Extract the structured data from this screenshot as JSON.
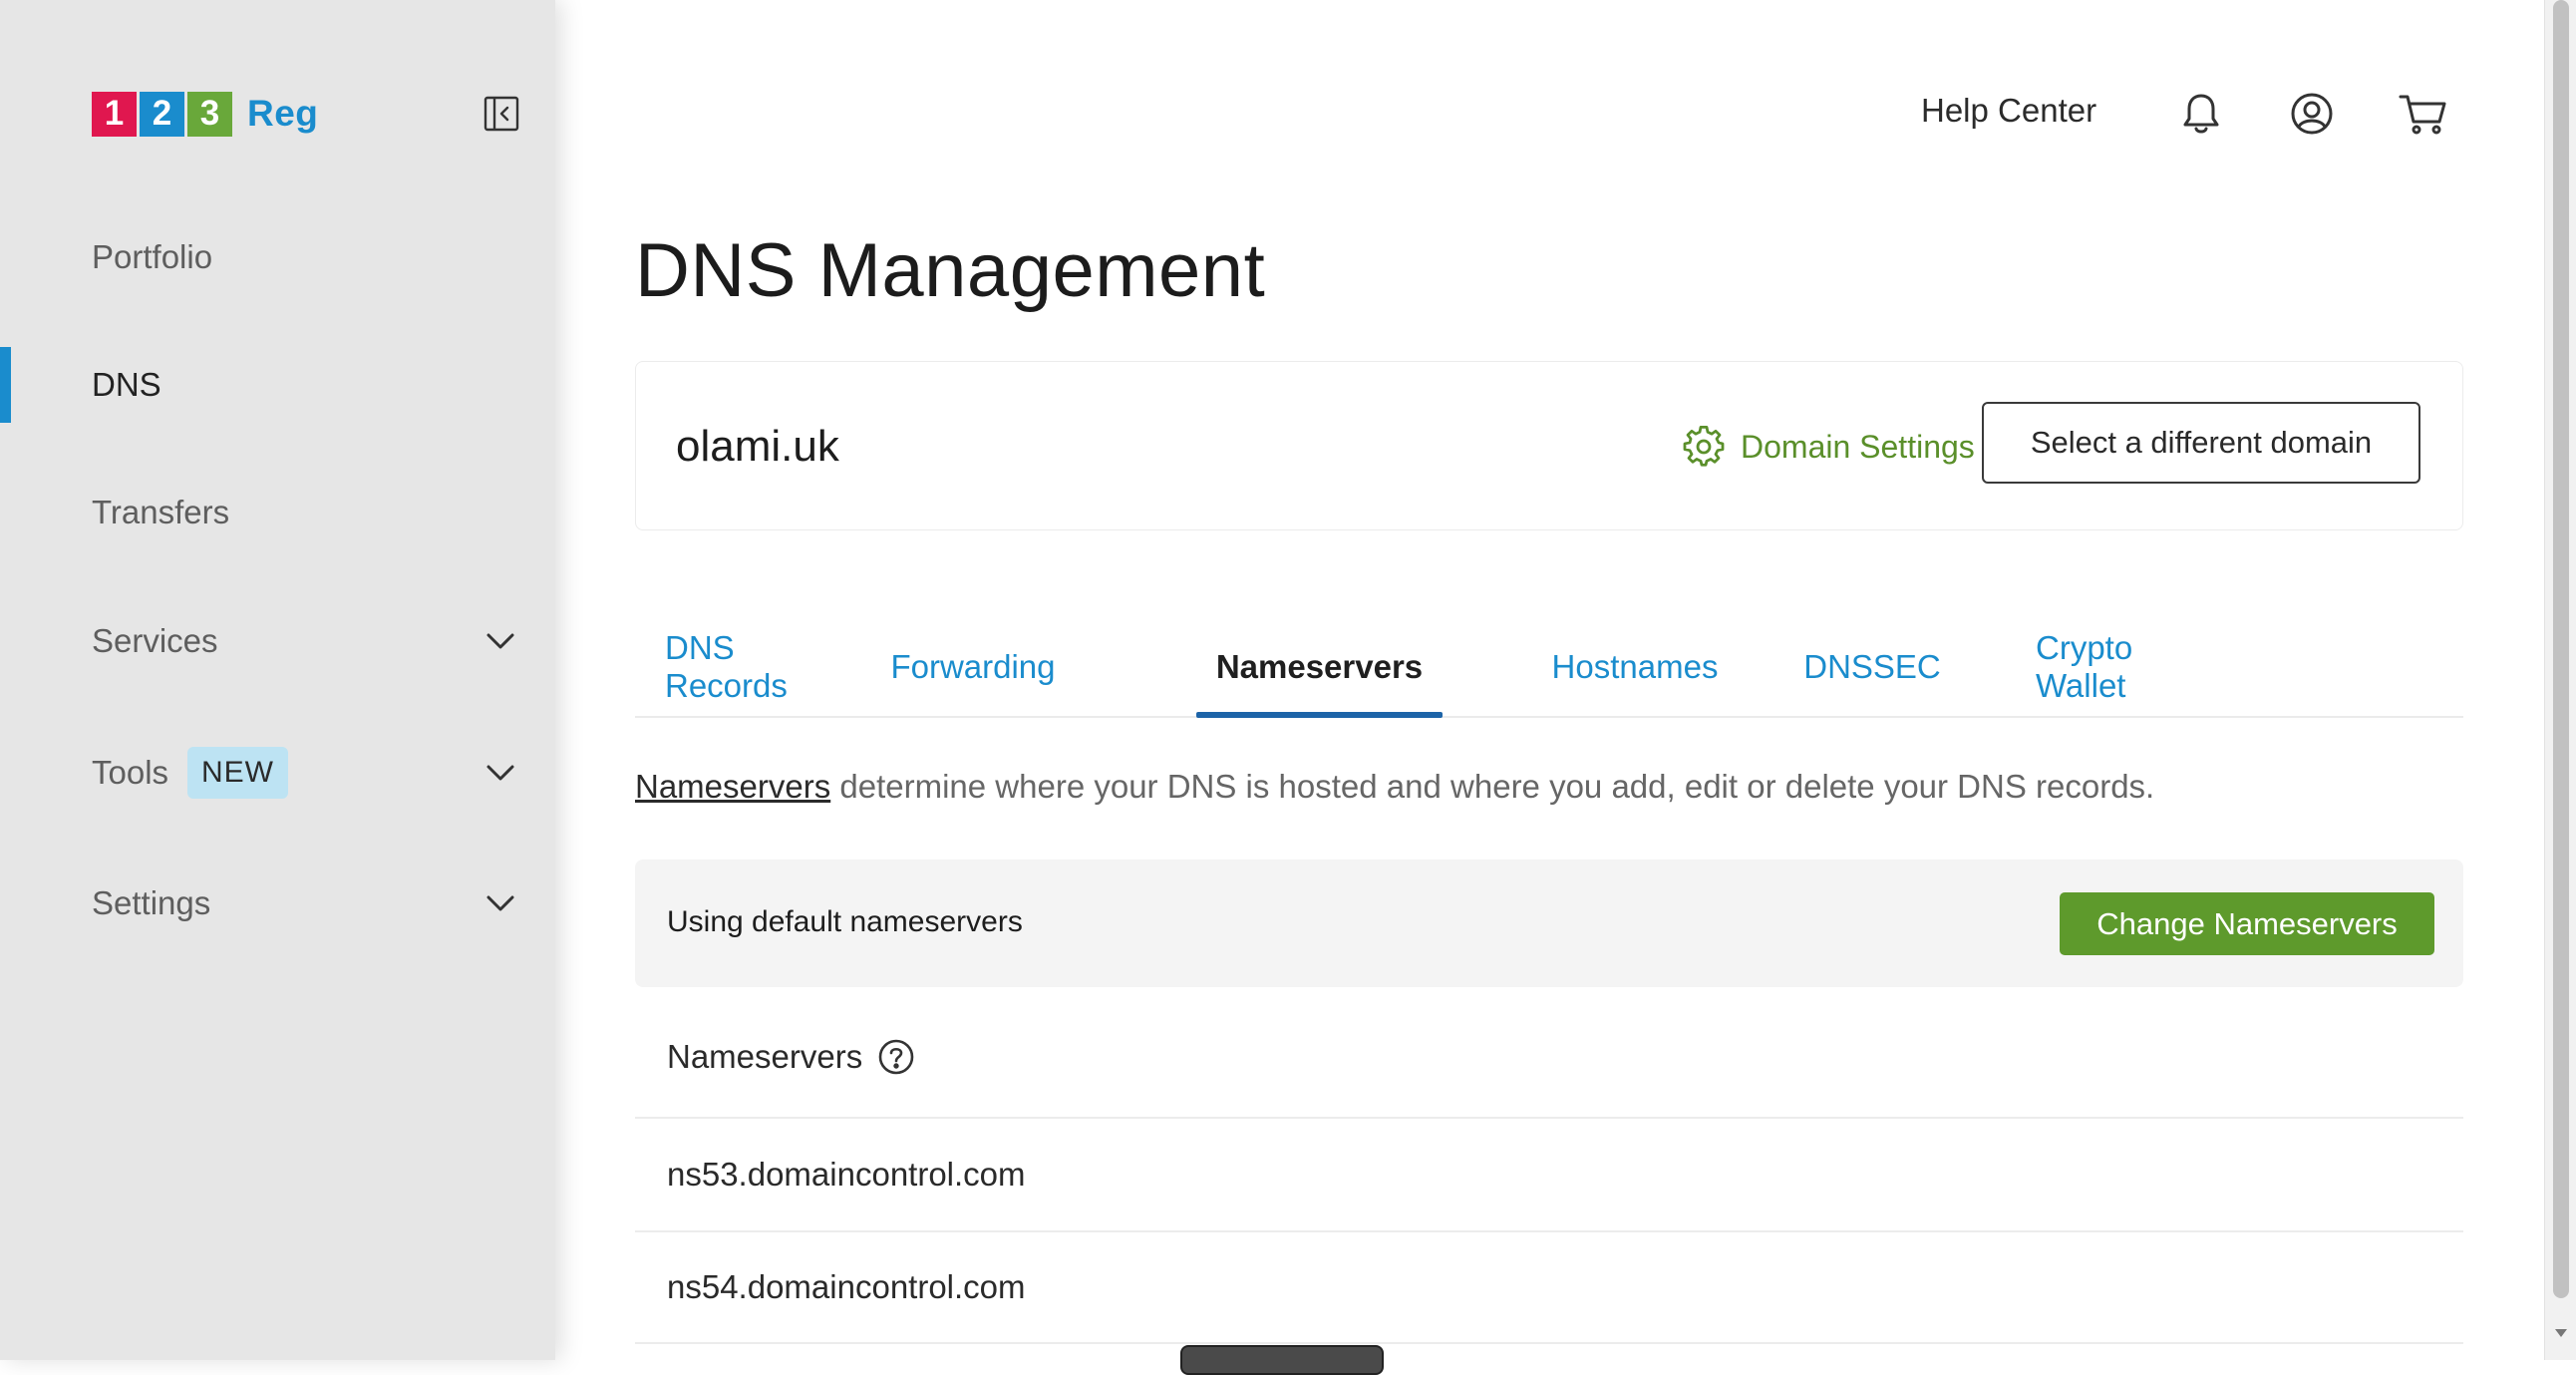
{
  "brand": {
    "digits": [
      "1",
      "2",
      "3"
    ],
    "digit_colors": [
      "#e0174f",
      "#1a8ccd",
      "#69a83a"
    ],
    "name": "Reg"
  },
  "sidebar": {
    "collapse_icon": "sidebar-collapse-icon",
    "items": [
      {
        "label": "Portfolio",
        "active": false,
        "has_chevron": false
      },
      {
        "label": "DNS",
        "active": true,
        "has_chevron": false
      },
      {
        "label": "Transfers",
        "active": false,
        "has_chevron": false
      },
      {
        "label": "Services",
        "active": false,
        "has_chevron": true
      },
      {
        "label": "Tools",
        "active": false,
        "has_chevron": true,
        "badge": "NEW"
      },
      {
        "label": "Settings",
        "active": false,
        "has_chevron": true
      }
    ]
  },
  "header": {
    "help_label": "Help Center",
    "icons": [
      "bell-icon",
      "account-icon",
      "cart-icon"
    ]
  },
  "page": {
    "title": "DNS Management"
  },
  "domain": {
    "name": "olami.uk",
    "settings_label": "Domain Settings",
    "select_label": "Select a different domain"
  },
  "tabs": [
    {
      "label": "DNS Records",
      "active": false
    },
    {
      "label": "Forwarding",
      "active": false
    },
    {
      "label": "Nameservers",
      "active": true
    },
    {
      "label": "Hostnames",
      "active": false
    },
    {
      "label": "DNSSEC",
      "active": false
    },
    {
      "label": "Crypto Wallet",
      "active": false
    }
  ],
  "description": {
    "link": "Nameservers",
    "text": " determine where your DNS is hosted and where you add, edit or delete your DNS records."
  },
  "status": {
    "text": "Using default nameservers",
    "button_label": "Change Nameservers"
  },
  "nameservers": {
    "header": "Nameservers",
    "entries": [
      "ns53.domaincontrol.com",
      "ns54.domaincontrol.com"
    ]
  },
  "colors": {
    "accent_blue": "#1a8ccd",
    "accent_green": "#5e9a2c",
    "tab_underline": "#1d64a8",
    "sidebar_bg": "#e6e6e6"
  }
}
